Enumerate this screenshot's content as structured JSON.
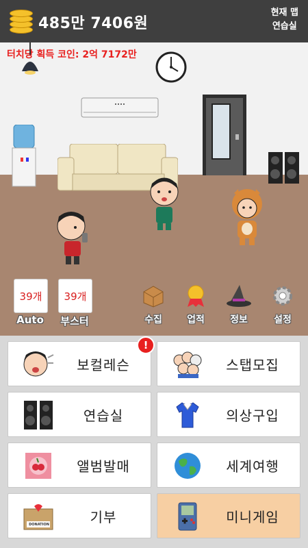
{
  "header": {
    "money": "485만 7406원",
    "map_title": "현재 맵",
    "map_name": "연습실"
  },
  "scene": {
    "touch_coin_text": "터치당 획득 코인: 2억 7172만"
  },
  "slots": [
    {
      "count": "39개",
      "label": "Auto"
    },
    {
      "count": "39개",
      "label": "부스터"
    }
  ],
  "quick_menu": [
    {
      "label": "수집",
      "icon": "box-icon"
    },
    {
      "label": "업적",
      "icon": "medal-icon"
    },
    {
      "label": "정보",
      "icon": "witch-hat-icon"
    },
    {
      "label": "설정",
      "icon": "gear-icon"
    }
  ],
  "buttons": [
    {
      "label": "보컬레슨",
      "icon": "singing-face-icon",
      "badge": "!"
    },
    {
      "label": "스탭모집",
      "icon": "staff-group-icon"
    },
    {
      "label": "연습실",
      "icon": "speaker-icon"
    },
    {
      "label": "의상구입",
      "icon": "shirt-icon"
    },
    {
      "label": "앨범발매",
      "icon": "album-icon"
    },
    {
      "label": "세계여행",
      "icon": "globe-icon"
    },
    {
      "label": "기부",
      "icon": "donation-box-icon",
      "donation_text": "DONATION"
    },
    {
      "label": "미니게임",
      "icon": "gameboy-icon"
    }
  ],
  "colors": {
    "topbar": "#3f3f3f",
    "coin": "#f4c12b",
    "touch_text": "#e8201f",
    "floor": "#a88670",
    "minigame_button": "#f7cfa3"
  }
}
